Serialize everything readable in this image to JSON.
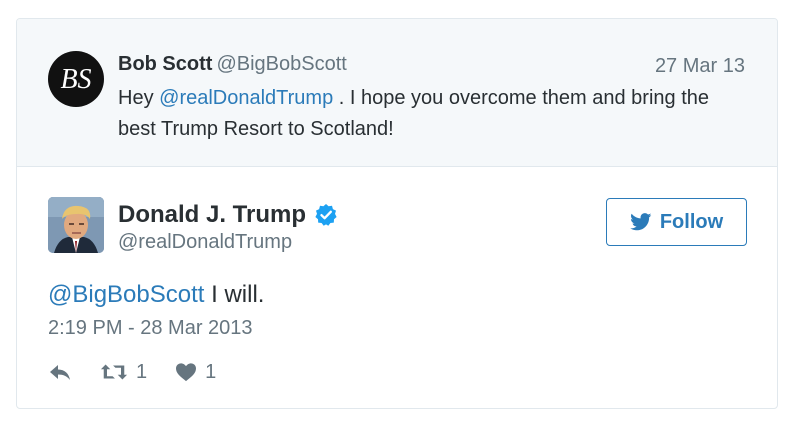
{
  "parent_tweet": {
    "avatar_initials": "BS",
    "name": "Bob Scott",
    "handle": "@BigBobScott",
    "date": "27 Mar 13",
    "text_prefix": "Hey",
    "mention": "@realDonaldTrump",
    "text_suffix": " . I hope you overcome them and bring the best Trump Resort to Scotland!"
  },
  "tweet": {
    "name": "Donald J. Trump",
    "handle": "@realDonaldTrump",
    "follow_label": "Follow",
    "mention": "@BigBobScott",
    "text": " I will.",
    "timestamp": "2:19 PM - 28 Mar 2013",
    "retweet_count": "1",
    "like_count": "1"
  },
  "colors": {
    "link": "#2b7bb9",
    "verified": "#1da1f2",
    "muted": "#66757f",
    "text": "#292f33",
    "parent_bg": "#f5f8fa"
  },
  "icons": [
    "reply-icon",
    "retweet-icon",
    "heart-icon",
    "twitter-bird-icon",
    "verified-badge-icon"
  ]
}
